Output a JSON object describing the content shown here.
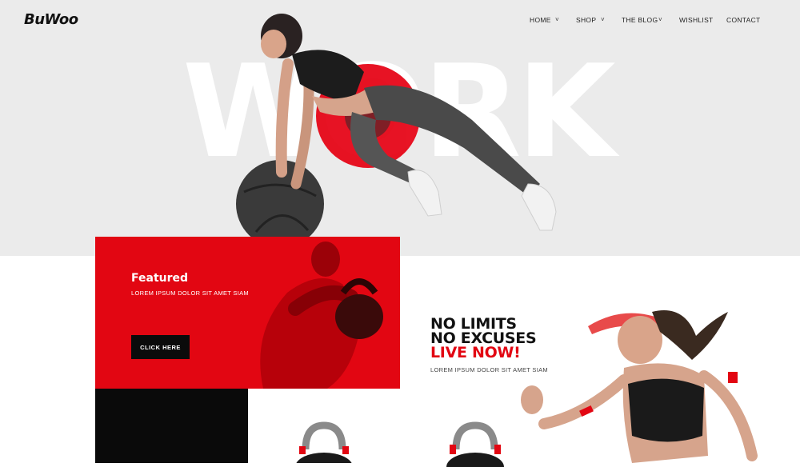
{
  "brand": {
    "logo": "BuWoo"
  },
  "nav": {
    "items": [
      {
        "label": "HOME",
        "has_dropdown": true
      },
      {
        "label": "SHOP",
        "has_dropdown": true
      },
      {
        "label": "THE BLOG",
        "has_dropdown": true
      },
      {
        "label": "WISHLIST",
        "has_dropdown": false
      },
      {
        "label": "CONTACT",
        "has_dropdown": false
      }
    ],
    "chevron": "˅"
  },
  "hero": {
    "big_word": "WORK",
    "accent_color": "#e60012"
  },
  "featured": {
    "title": "Featured",
    "subtitle": "LOREM IPSUM DOLOR SIT AMET SIAM",
    "button_label": "CLICK HERE",
    "bg_color": "#e20612"
  },
  "promo": {
    "line1": "NO LIMITS",
    "line2": "NO EXCUSES",
    "line3": "LIVE NOW!",
    "subtitle": "LOREM IPSUM DOLOR SIT AMET SIAM"
  },
  "icons": {
    "chevron": "chevron-down-icon"
  }
}
